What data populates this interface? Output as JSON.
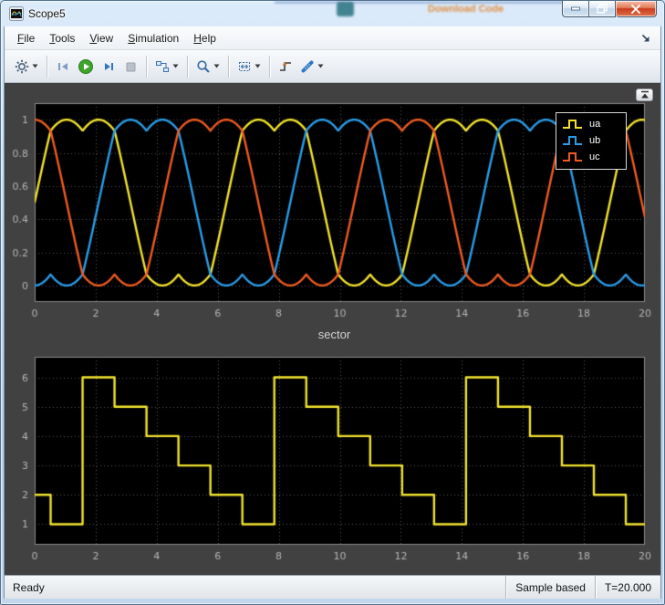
{
  "window": {
    "title": "Scope5",
    "buttons": [
      "minimize",
      "restore",
      "close"
    ]
  },
  "background": {
    "bleed_text": "Download Code"
  },
  "menu": {
    "items": [
      {
        "label": "File"
      },
      {
        "label": "Tools"
      },
      {
        "label": "View"
      },
      {
        "label": "Simulation"
      },
      {
        "label": "Help"
      }
    ]
  },
  "toolbar": {
    "buttons": [
      "settings",
      "step-back",
      "run",
      "step-forward",
      "stop",
      "highlight-simulink-block",
      "zoom",
      "span",
      "trigger",
      "measurements"
    ]
  },
  "status": {
    "left": "Ready",
    "sample": "Sample based",
    "time": "T=20.000"
  },
  "chart_data": [
    {
      "type": "line",
      "title": "",
      "xlim": [
        0,
        20
      ],
      "ylim": [
        -0.1,
        1.1
      ],
      "xticks": [
        "0",
        "2",
        "4",
        "6",
        "8",
        "10",
        "12",
        "14",
        "16",
        "18",
        "20"
      ],
      "yticks": [
        "0",
        "0.2",
        "0.4",
        "0.6",
        "0.8",
        "1"
      ],
      "grid": true,
      "legend_position": "top-right",
      "background": "#000000",
      "sample_step": 0.02,
      "model": "three-phase SVPWM saddle duty cycles: u(t)=0.5+(sin(t+phase)-vcm(t))/sqrt(3), vcm=(max+min)/2 of the three phase sines, t in radians, peaks=1, valleys=0, period 2*pi",
      "series": [
        {
          "name": "ua",
          "color": "#f2e22e",
          "phase_deg": 0
        },
        {
          "name": "ub",
          "color": "#2b9ce8",
          "phase_deg": -120
        },
        {
          "name": "uc",
          "color": "#ee5b22",
          "phase_deg": 120
        }
      ]
    },
    {
      "type": "step",
      "title": "sector",
      "xlim": [
        0,
        20
      ],
      "ylim": [
        0.3,
        6.7
      ],
      "xticks": [
        "0",
        "2",
        "4",
        "6",
        "8",
        "10",
        "12",
        "14",
        "16",
        "18",
        "20"
      ],
      "yticks": [
        "1",
        "2",
        "3",
        "4",
        "5",
        "6"
      ],
      "grid": true,
      "background": "#000000",
      "series": [
        {
          "name": "sector",
          "color": "#f2e22e"
        }
      ],
      "steps": [
        [
          0,
          2
        ],
        [
          0.5236,
          1
        ],
        [
          1.5708,
          6
        ],
        [
          2.618,
          5
        ],
        [
          3.6652,
          4
        ],
        [
          4.7124,
          3
        ],
        [
          5.7596,
          2
        ],
        [
          6.8068,
          1
        ],
        [
          7.854,
          6
        ],
        [
          8.9012,
          5
        ],
        [
          9.9484,
          4
        ],
        [
          10.9956,
          3
        ],
        [
          12.0428,
          2
        ],
        [
          13.09,
          1
        ],
        [
          14.1372,
          6
        ],
        [
          15.1844,
          5
        ],
        [
          16.2316,
          4
        ],
        [
          17.2788,
          3
        ],
        [
          18.326,
          2
        ],
        [
          19.3732,
          1
        ]
      ],
      "x_end": 20
    }
  ]
}
